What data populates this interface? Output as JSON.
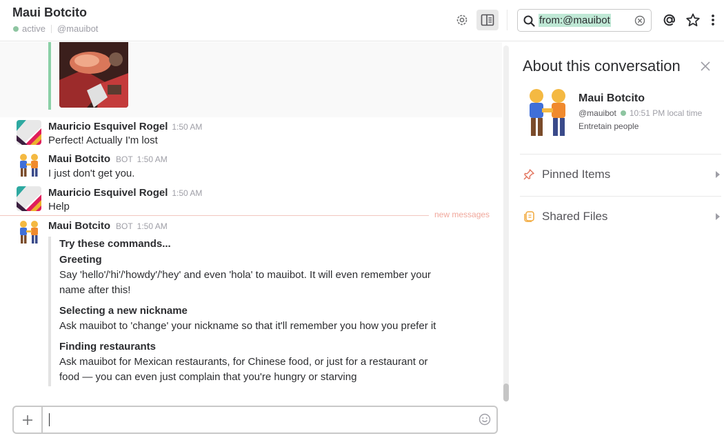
{
  "header": {
    "channel_name": "Maui Botcito",
    "presence": "active",
    "handle": "@mauibot",
    "search_query": "from:@mauibot"
  },
  "icons": {
    "settings": "gear-icon",
    "details": "sidebar-toggle-icon",
    "search": "search-icon",
    "clear": "clear-icon",
    "mentions": "at-icon",
    "starred": "star-icon",
    "more": "kebab-icon"
  },
  "colors": {
    "presence": "#8ec5a1",
    "new_messages": "#f0a79b",
    "search_highlight": "#bfe8d5"
  },
  "messages": [
    {
      "sender": "Mauricio Esquivel Rogel",
      "time": "1:50 AM",
      "text": "Perfect! Actually I'm lost"
    },
    {
      "sender": "Maui Botcito",
      "badge": "BOT",
      "time": "1:50 AM",
      "text": "I just don't get you."
    },
    {
      "sender": "Mauricio Esquivel Rogel",
      "time": "1:50 AM",
      "text": "Help"
    },
    {
      "sender": "Maui Botcito",
      "badge": "BOT",
      "time": "1:50 AM"
    }
  ],
  "new_messages_label": "new messages",
  "attachment": {
    "pretext": "Try these commands...",
    "sections": [
      {
        "title": "Greeting",
        "lines": [
          "Say 'hello'/'hi'/'howdy'/'hey' and even 'hola' to mauibot. It will even remember your",
          "name after this!"
        ]
      },
      {
        "title": "Selecting a new nickname",
        "lines": [
          "Ask mauibot to 'change' your nickname so that it'll remember you how you prefer it"
        ]
      },
      {
        "title": "Finding restaurants",
        "lines": [
          "Ask mauibot for Mexican restaurants, for Chinese food, or just for a restaurant or",
          "food — you can even just complain that you're hungry or starving"
        ]
      }
    ]
  },
  "sidebar": {
    "title": "About this conversation",
    "profile_name": "Maui Botcito",
    "profile_handle": "@mauibot",
    "local_time": "10:51 PM local time",
    "description": "Entretain people",
    "pinned_label": "Pinned Items",
    "files_label": "Shared Files"
  }
}
